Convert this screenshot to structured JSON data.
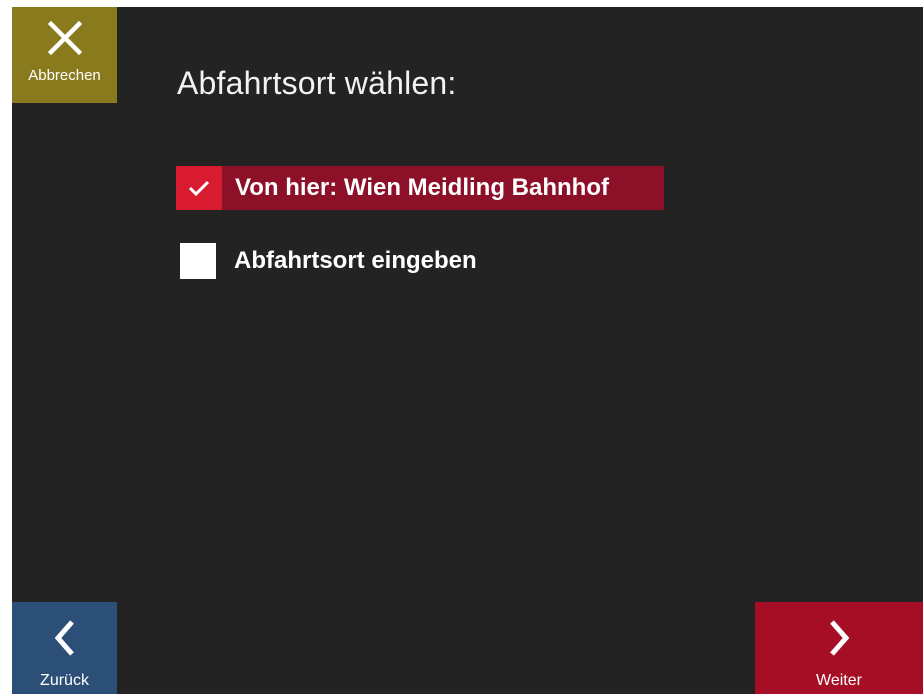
{
  "header": {
    "cancel_label": "Abbrechen",
    "cancel_icon": "close-icon",
    "cancel_color": "#8a7a1e"
  },
  "main": {
    "title": "Abfahrtsort wählen:",
    "options": [
      {
        "label": "Von hier: Wien Meidling Bahnhof",
        "selected": true,
        "icon": "checkmark-icon",
        "color": "#d81b2f"
      },
      {
        "label": "Abfahrtsort eingeben",
        "selected": false
      }
    ]
  },
  "footer": {
    "back_label": "Zurück",
    "back_icon": "chevron-left-icon",
    "back_color": "#2c4f78",
    "next_label": "Weiter",
    "next_icon": "chevron-right-icon",
    "next_color": "#a50e24"
  }
}
